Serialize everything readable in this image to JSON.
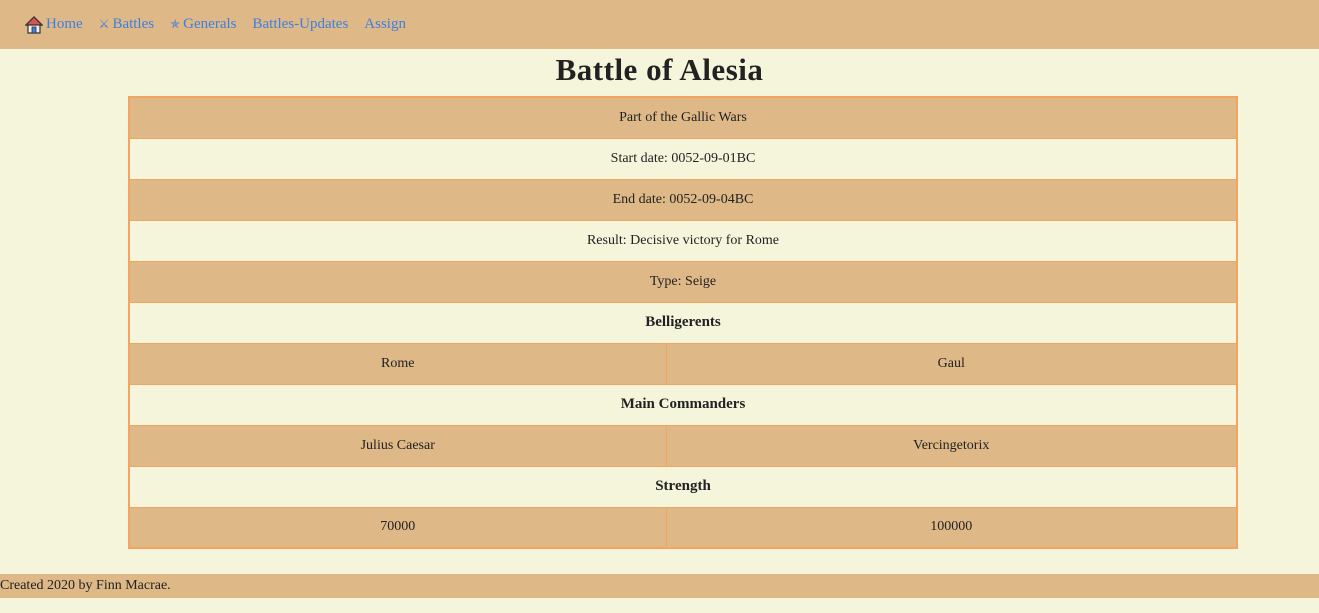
{
  "nav": {
    "items": [
      {
        "label": "Home",
        "icon": "home-icon"
      },
      {
        "label": "Battles",
        "icon": "crossed-swords-icon"
      },
      {
        "label": "Generals",
        "icon": "star-icon"
      },
      {
        "label": "Battles-Updates"
      },
      {
        "label": "Assign"
      }
    ],
    "link_color": "#3d7fe0"
  },
  "battle": {
    "title": "Battle of Alesia",
    "part_of": "Part of  the Gallic Wars",
    "start_date": "Start date: 0052-09-01BC",
    "end_date": "End date: 0052-09-04BC",
    "result": "Result: Decisive victory for Rome",
    "type": "Type: Seige",
    "belligerents_heading": "Belligerents",
    "belligerents": [
      "Rome",
      "Gaul"
    ],
    "commanders_heading": "Main Commanders",
    "commanders": [
      "Julius Caesar",
      "Vercingetorix"
    ],
    "strength_heading": "Strength",
    "strength": [
      "70000",
      "100000"
    ]
  },
  "footer": {
    "text": "Created 2020 by Finn Macrae."
  },
  "colors": {
    "tan": "#deb887",
    "cream": "#f5f5dc",
    "border": "#f4a460"
  }
}
